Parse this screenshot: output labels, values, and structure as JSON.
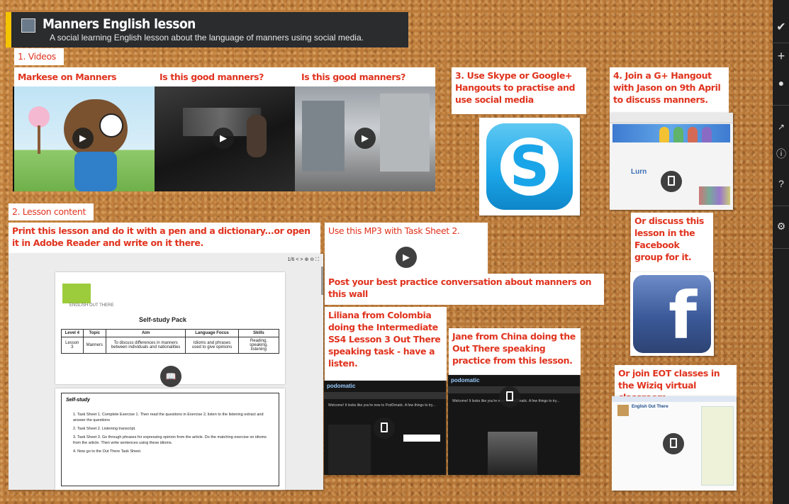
{
  "header": {
    "title": "Manners English lesson",
    "subtitle": "A social learning English lesson about the language of manners using social media."
  },
  "section_videos": "1. Videos",
  "videos": [
    {
      "label": "Markese on Manners"
    },
    {
      "label": "Is this good manners?"
    },
    {
      "label": "Is this good manners?"
    }
  ],
  "skype": {
    "label": "3. Use Skype or Google+ Hangouts to practise and use social media"
  },
  "hangout": {
    "label": "4. Join a G+ Hangout with Jason on 9th April to discuss manners."
  },
  "section_lesson": "2. Lesson content",
  "print_note": "Print this lesson and do it with a pen and a dictionary...or open it in Adobe Reader and write on it there.",
  "pdf": {
    "page": "1/6",
    "brand": "ENGLISH OUT THERE",
    "heading": "Self-study Pack",
    "table_headers": [
      "Level 4",
      "Topic",
      "Aim",
      "Language Focus",
      "Skills"
    ],
    "table_row": [
      "Lesson 3",
      "Manners",
      "To discuss differences in manners between individuals and nationalities",
      "Idioms and phrases used to give opinions",
      "Reading, speaking, listening"
    ],
    "self_study_title": "Self-study",
    "tasks": [
      "1.   Task Sheet 1. Complete Exercise 1. Then read the questions in Exercise 2, listen to the listening extract and answer the questions",
      "2.   Task Sheet 2. Listening transcript.",
      "3.   Task Sheet 3. Go through phrases for expressing opinion from the article. Do the matching exercise on idioms from the article. Then write sentences using these idioms.",
      "4.   Now go to the Out There Task Sheet."
    ]
  },
  "mp3_note": "Use this MP3 with Task Sheet 2.",
  "post_note": "Post your best practice conversation about manners on this wall",
  "liliana": "Liliana from Colombia doing the Intermediate SS4 Lesson 3 Out There speaking task - have a listen.",
  "jane": "Jane from China doing the Out There speaking practice from this lesson.",
  "podomatic": {
    "brand": "podomatic",
    "welcome": "Welcome! It looks like you're new to PodOmatic. A few things to try..."
  },
  "facebook": {
    "label": "Or discuss this lesson in the Facebook group for it."
  },
  "wiziq": {
    "label": "Or join EOT classes in the Wiziq virtual classroom.",
    "page_title": "English Out There"
  },
  "colors": {
    "accent_red": "#e0341f",
    "header_bg": "#2a2c2e",
    "header_bar": "#f4c400",
    "skype_blue": "#1aa5e8",
    "facebook_blue": "#3b5998",
    "sidebar_bg": "#1e1e1e"
  },
  "sidebar": {
    "icons": [
      "bird-logo-icon",
      "plus-icon",
      "user-icon",
      "share-icon",
      "info-icon",
      "help-icon",
      "gear-icon"
    ]
  }
}
